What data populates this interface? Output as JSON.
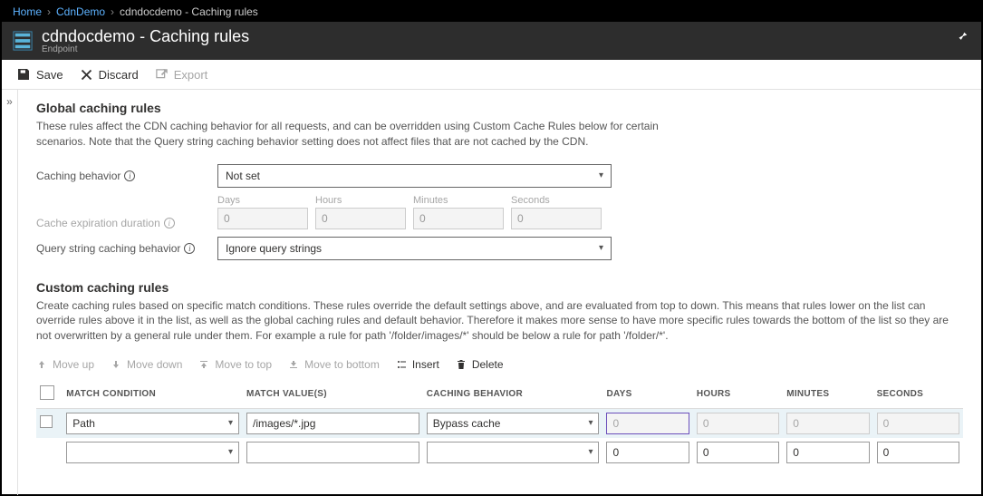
{
  "breadcrumb": {
    "home": "Home",
    "parent": "CdnDemo",
    "current": "cdndocdemo - Caching rules"
  },
  "header": {
    "title": "cdndocdemo - Caching rules",
    "subtitle": "Endpoint"
  },
  "toolbar": {
    "save": "Save",
    "discard": "Discard",
    "export": "Export"
  },
  "global": {
    "title": "Global caching rules",
    "desc": "These rules affect the CDN caching behavior for all requests, and can be overridden using Custom Cache Rules below for certain scenarios. Note that the Query string caching behavior setting does not affect files that are not cached by the CDN.",
    "caching_behavior_label": "Caching behavior",
    "caching_behavior_value": "Not set",
    "cache_expiration_label": "Cache expiration duration",
    "duration": {
      "days_label": "Days",
      "hours_label": "Hours",
      "minutes_label": "Minutes",
      "seconds_label": "Seconds",
      "days_value": "0",
      "hours_value": "0",
      "minutes_value": "0",
      "seconds_value": "0"
    },
    "query_string_label": "Query string caching behavior",
    "query_string_value": "Ignore query strings"
  },
  "custom": {
    "title": "Custom caching rules",
    "desc": "Create caching rules based on specific match conditions. These rules override the default settings above, and are evaluated from top to down. This means that rules lower on the list can override rules above it in the list, as well as the global caching rules and default behavior. Therefore it makes more sense to have more specific rules towards the bottom of the list so they are not overwritten by a general rule under them. For example a rule for path '/folder/images/*' should be below a rule for path '/folder/*'.",
    "toolbar": {
      "move_up": "Move up",
      "move_down": "Move down",
      "move_top": "Move to top",
      "move_bottom": "Move to bottom",
      "insert": "Insert",
      "delete": "Delete"
    },
    "columns": {
      "match_condition": "MATCH CONDITION",
      "match_values": "MATCH VALUE(S)",
      "caching_behavior": "CACHING BEHAVIOR",
      "days": "DAYS",
      "hours": "HOURS",
      "minutes": "MINUTES",
      "seconds": "SECONDS"
    },
    "rows": [
      {
        "match_condition": "Path",
        "match_value": "/images/*.jpg",
        "caching_behavior": "Bypass cache",
        "days": "0",
        "hours": "0",
        "minutes": "0",
        "seconds": "0",
        "duration_disabled": true
      },
      {
        "match_condition": "",
        "match_value": "",
        "caching_behavior": "",
        "days": "0",
        "hours": "0",
        "minutes": "0",
        "seconds": "0",
        "duration_disabled": false
      }
    ]
  }
}
